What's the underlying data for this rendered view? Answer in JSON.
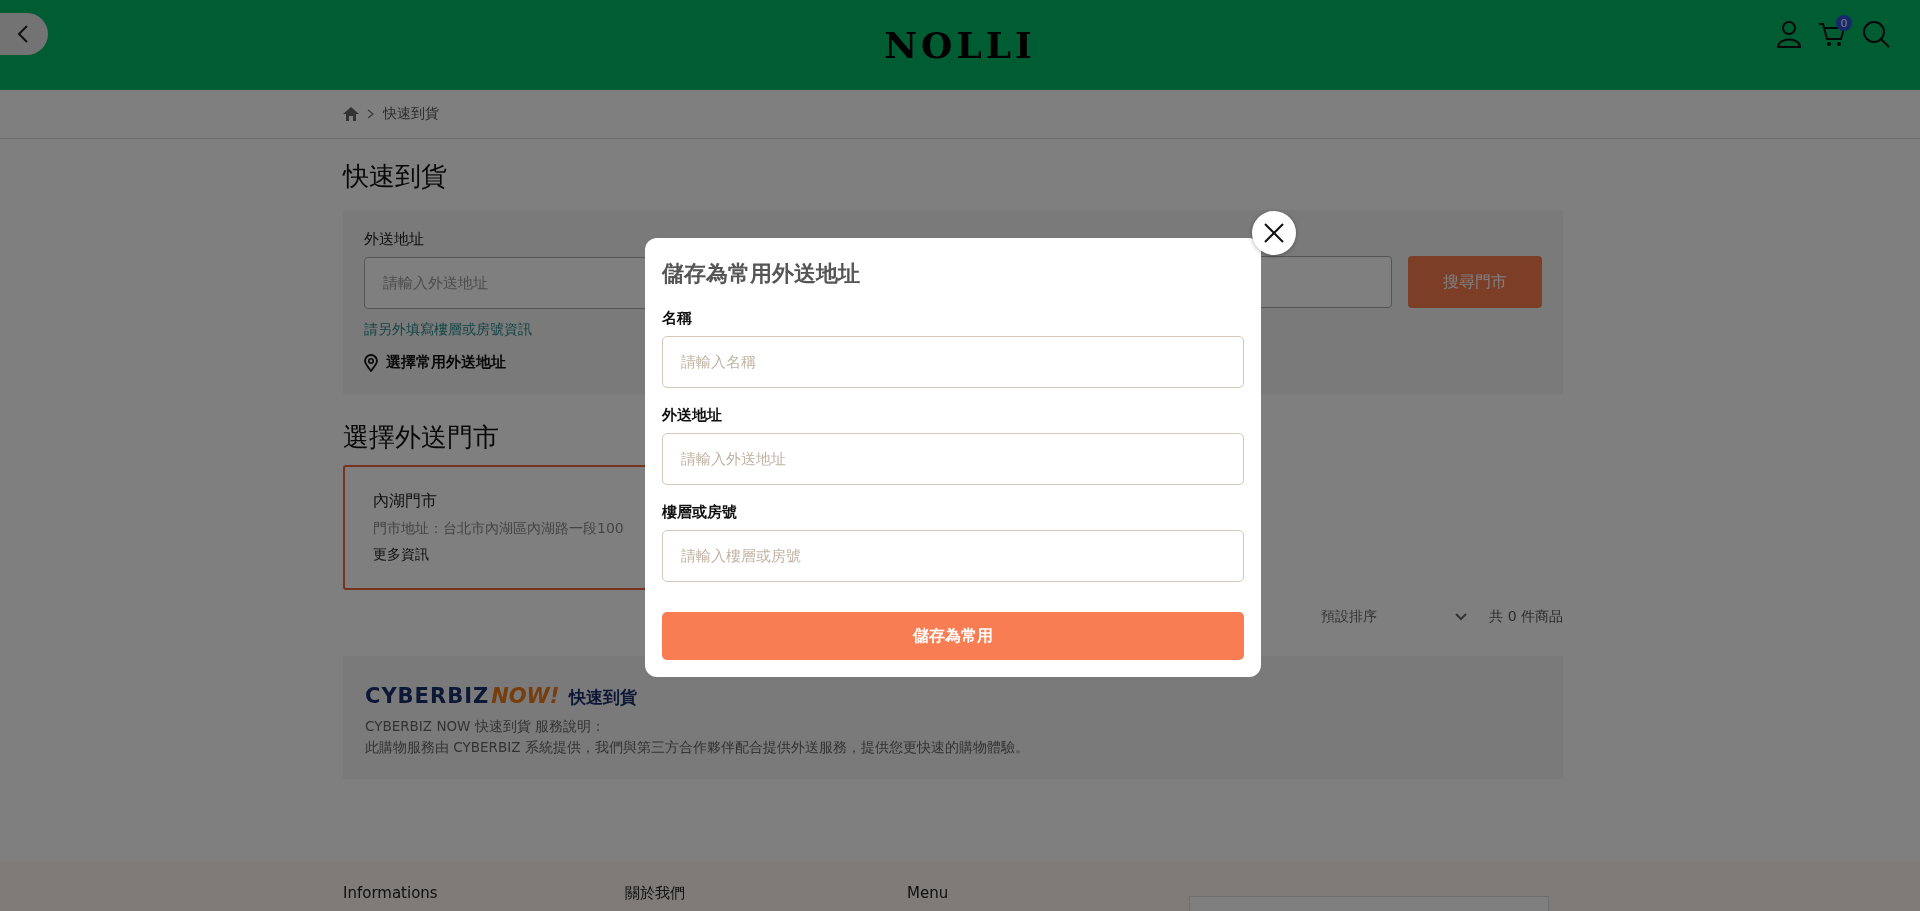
{
  "header": {
    "logo": "NOLLI",
    "cart_count": "0"
  },
  "breadcrumb": [
    "快速到貨"
  ],
  "page_title": "快速到貨",
  "delivery_form": {
    "address_label": "外送地址",
    "address_placeholder": "請輸入外送地址",
    "hint": "請另外填寫樓層或房號資訊",
    "saved_address_link": "選擇常用外送地址",
    "search_button": "搜尋門市"
  },
  "stores_title": "選擇外送門市",
  "stores": [
    {
      "name": "內湖門市",
      "address": "門市地址：台北市內湖區內湖路一段100",
      "more": "更多資訊",
      "selected": true
    }
  ],
  "sort": {
    "value": "預設排序"
  },
  "product_count": "共 0 件商品",
  "service": {
    "logo_brand": "CYBERBIZ",
    "logo_now": "NOW!",
    "logo_title": "快速到貨",
    "lines": [
      "CYBERBIZ NOW 快速到貨 服務說明：",
      "此購物服務由 CYBERBIZ 系統提供，我們與第三方合作夥伴配合提供外送服務，提供您更快速的購物體驗。"
    ]
  },
  "footer": {
    "columns": [
      "Informations",
      "關於我們",
      "Menu"
    ]
  },
  "modal": {
    "title": "儲存為常用外送地址",
    "fields": [
      {
        "label": "名稱",
        "placeholder": "請輸入名稱"
      },
      {
        "label": "外送地址",
        "placeholder": "請輸入外送地址"
      },
      {
        "label": "樓層或房號",
        "placeholder": "請輸入樓層或房號"
      }
    ],
    "submit": "儲存為常用"
  }
}
